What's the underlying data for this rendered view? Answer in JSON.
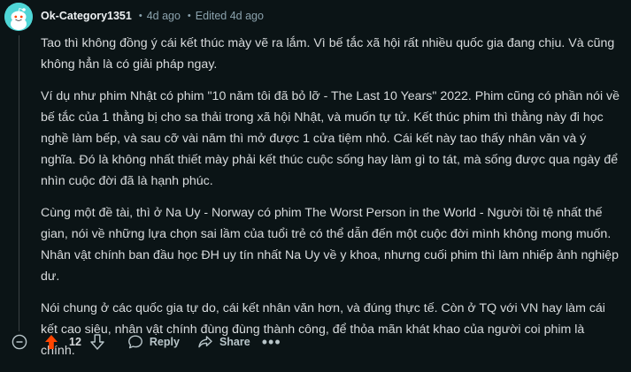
{
  "comment": {
    "author": "Ok-Category1351",
    "separator": "•",
    "time_ago": "4d ago",
    "edited": "Edited 4d ago",
    "paragraphs": [
      "Tao thì không đồng ý cái kết thúc mày vẽ ra lắm. Vì bế tắc xã hội rất nhiều quốc gia đang chịu. Và cũng không hẳn là có giải pháp ngay.",
      "Ví dụ như phim Nhật có phim \"10 năm tôi đã bỏ lỡ - The Last 10 Years\" 2022. Phim cũng có phần nói về bế tắc của 1 thằng bị cho sa thải trong xã hội Nhật, và muốn tự tử. Kết thúc phim thì thằng này đi học nghề làm bếp, và sau cỡ vài năm thì mở được 1 cửa tiệm nhỏ. Cái kết này tao thấy nhân văn và ý nghĩa. Đó là không nhất thiết mày phải kết thúc cuộc sống hay làm gì to tát, mà sống được qua ngày để nhìn cuộc đời đã là hạnh phúc.",
      "Cùng một đề tài, thì ở Na Uy - Norway có phim The Worst Person in the World - Người tồi tệ nhất thế gian, nói về những lựa chọn sai lầm của tuổi trẻ có thể dẫn đến một cuộc đời mình không mong muốn. Nhân vật chính ban đầu học ĐH uy tín nhất Na Uy về y khoa, nhưng cuối phim thì làm nhiếp ảnh nghiệp dư.",
      "Nói chung ở các quốc gia tự do, cái kết nhân văn hơn, và đúng thực tế. Còn ở TQ với VN hay làm cái kết cao siêu, nhân vật chính đùng đùng thành công, để thỏa mãn khát khao của người coi phim là chính."
    ]
  },
  "actions": {
    "collapse_icon": "minus-circle-icon",
    "upvote_icon": "upvote-arrow-icon",
    "score": "12",
    "downvote_icon": "downvote-arrow-icon",
    "reply_label": "Reply",
    "reply_icon": "speech-bubble-icon",
    "share_label": "Share",
    "share_icon": "share-arrow-icon",
    "more_icon": "ellipsis-icon",
    "more_glyph": "•••"
  },
  "colors": {
    "background": "#0b1416",
    "text": "#d7dadc",
    "meta": "#8ba2ad",
    "upvote_active": "#ff4500",
    "avatar": "#4fd6d6"
  }
}
